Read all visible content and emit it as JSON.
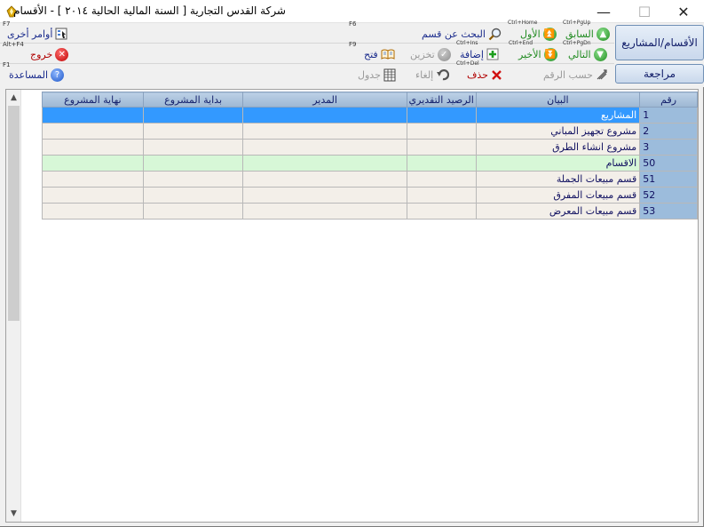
{
  "window": {
    "title": "شركة القدس التجارية  [ السنة المالية الحالية ٢٠١٤ ] - الأقسام",
    "minimize": "—",
    "maximize": "☐",
    "close": "✕"
  },
  "toolbar": {
    "previous_label": "السابق",
    "previous_shortcut": "Ctrl+PgUp",
    "first_label": "الأول",
    "first_shortcut": "Ctrl+Home",
    "search_label": "البحث عن قسم",
    "search_fkey": "F6",
    "other_label": "أوامر أخرى",
    "other_fkey": "F7",
    "next_label": "التالي",
    "next_shortcut": "Ctrl+PgDn",
    "last_label": "الأخير",
    "last_shortcut": "Ctrl+End",
    "add_label": "إضافة",
    "add_shortcut": "Ctrl+Ins",
    "store_label": "تخزين",
    "open_label": "فتح",
    "open_fkey": "F9",
    "exit_label": "خروج",
    "exit_fkey": "Alt+F4",
    "by_number_label": "حسب الرقم",
    "delete_label": "حذف",
    "delete_shortcut": "Ctrl+Del",
    "cancel_label": "إلغاء",
    "table_label": "جدول",
    "help_label": "المساعدة",
    "help_fkey": "F1",
    "sections_button": "الأقسام/المشاريع",
    "review_button": "مراجعة"
  },
  "grid": {
    "columns": [
      "رقم",
      "البيان",
      "الرصيد التقديري",
      "المدير",
      "بداية المشروع",
      "نهاية المشروع"
    ],
    "rows": [
      {
        "num": "1",
        "desc": "المشاريع",
        "balance": "",
        "manager": "",
        "start": "",
        "end": "",
        "state": "selected"
      },
      {
        "num": "2",
        "desc": "مشروع تجهيز المباني",
        "balance": "",
        "manager": "",
        "start": "",
        "end": "",
        "state": "plain"
      },
      {
        "num": "3",
        "desc": "مشروع انشاء الطرق",
        "balance": "",
        "manager": "",
        "start": "",
        "end": "",
        "state": "plain"
      },
      {
        "num": "50",
        "desc": "الاقسام",
        "balance": "",
        "manager": "",
        "start": "",
        "end": "",
        "state": "section"
      },
      {
        "num": "51",
        "desc": "قسم مبيعات الجملة",
        "balance": "",
        "manager": "",
        "start": "",
        "end": "",
        "state": "plain"
      },
      {
        "num": "52",
        "desc": "قسم مبيعات المفرق",
        "balance": "",
        "manager": "",
        "start": "",
        "end": "",
        "state": "plain"
      },
      {
        "num": "53",
        "desc": "قسم مبيعات المعرض",
        "balance": "",
        "manager": "",
        "start": "",
        "end": "",
        "state": "plain"
      }
    ]
  },
  "icons": {
    "previous": "arrow-up-circle-icon",
    "first": "double-arrow-up-circle-icon",
    "search": "magnifier-icon",
    "other": "toolbox-icon",
    "next": "arrow-down-circle-icon",
    "last": "double-arrow-down-circle-icon",
    "add": "plus-icon",
    "store": "check-circle-icon",
    "open": "open-book-icon",
    "exit": "close-circle-icon",
    "by_number": "sort-icon",
    "delete": "x-icon",
    "cancel": "undo-icon",
    "table": "table-icon",
    "help": "help-circle-icon"
  },
  "colors": {
    "selected_row": "#3399ff",
    "section_row": "#d7f7d7",
    "plain_row": "#f3efe9",
    "header": "#9db7d3",
    "number_cell": "#9cbcdc"
  }
}
